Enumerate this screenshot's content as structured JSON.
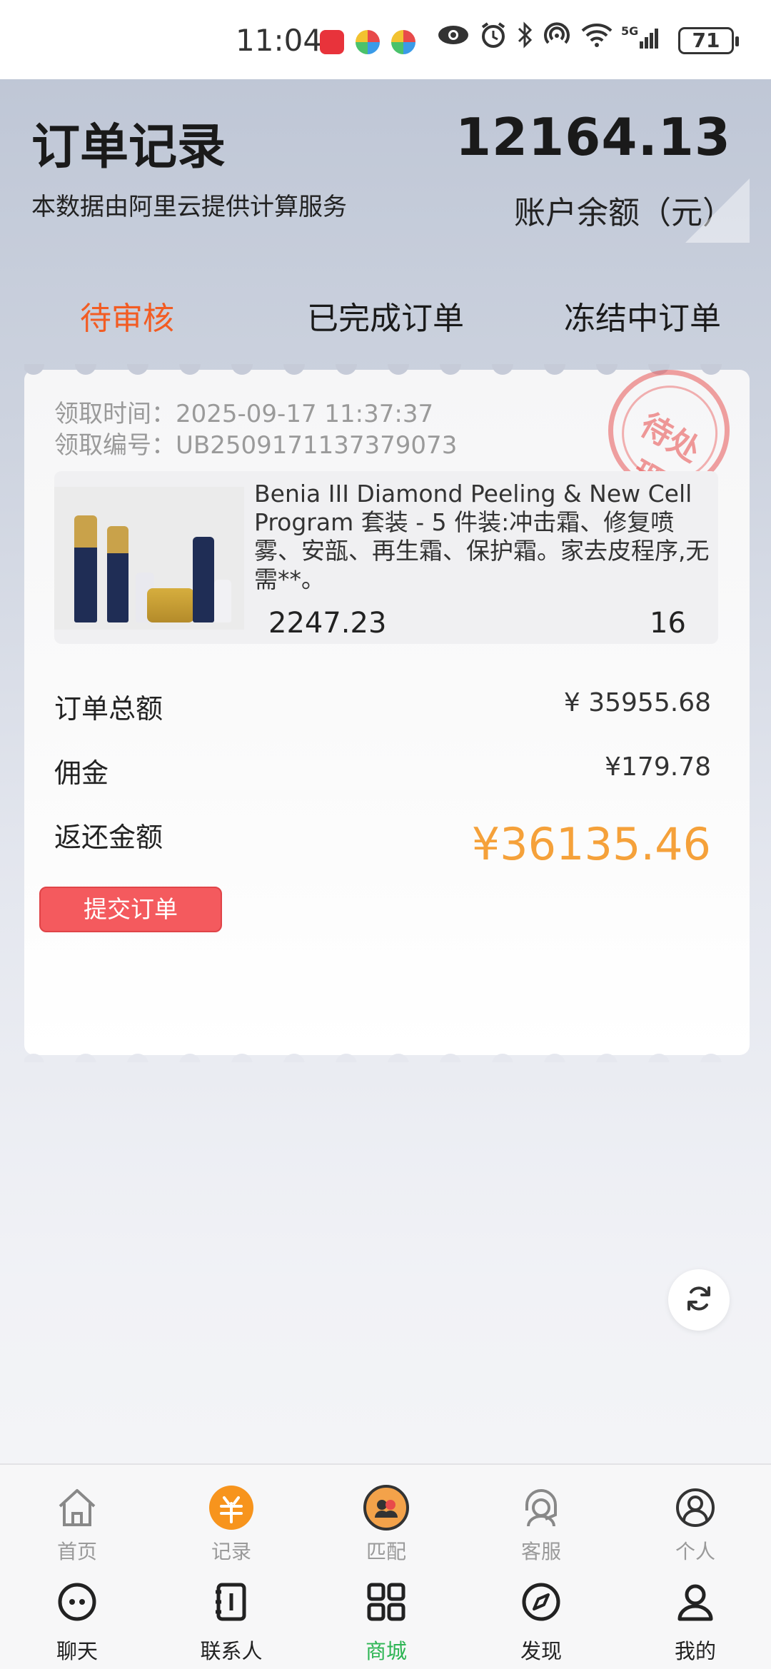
{
  "status_bar": {
    "time": "11:04",
    "battery": "71",
    "network": "5G"
  },
  "header": {
    "title": "订单记录",
    "subtitle": "本数据由阿里云提供计算服务",
    "balance": "12164.13",
    "balance_label": "账户余额（元）"
  },
  "tabs": [
    {
      "label": "待审核",
      "active": true
    },
    {
      "label": "已完成订单",
      "active": false
    },
    {
      "label": "冻结中订单",
      "active": false
    }
  ],
  "order": {
    "time_label": "领取时间：",
    "time_value": "2025-09-17 11:37:37",
    "id_label": "领取编号：",
    "id_value": "UB2509171137379073",
    "stamp": "待处理",
    "product_name": "Benia III Diamond Peeling & New Cell Program 套装 - 5 件装:冲击霜、修复喷雾、安瓿、再生霜、保护霜。家去皮程序,无需**。",
    "unit_price": "2247.23",
    "quantity": "16",
    "total_label": "订单总额",
    "total_value": "¥ 35955.68",
    "commission_label": "佣金",
    "commission_value": "¥179.78",
    "return_label": "返还金额",
    "return_value": "¥36135.46",
    "submit_label": "提交订单"
  },
  "bottom_nav_top": [
    {
      "label": "首页",
      "icon": "home-icon"
    },
    {
      "label": "记录",
      "icon": "record-icon"
    },
    {
      "label": "匹配",
      "icon": "match-icon"
    },
    {
      "label": "客服",
      "icon": "support-icon"
    },
    {
      "label": "个人",
      "icon": "profile-icon"
    }
  ],
  "bottom_nav_bottom": [
    {
      "label": "聊天",
      "icon": "chat-icon"
    },
    {
      "label": "联系人",
      "icon": "contacts-icon"
    },
    {
      "label": "商城",
      "icon": "mall-icon",
      "active": true
    },
    {
      "label": "发现",
      "icon": "discover-icon"
    },
    {
      "label": "我的",
      "icon": "me-icon"
    }
  ],
  "colors": {
    "accent_orange": "#f25c23",
    "return_amount": "#f5a13a",
    "submit_button": "#f45a5e",
    "active_green": "#2db553"
  }
}
